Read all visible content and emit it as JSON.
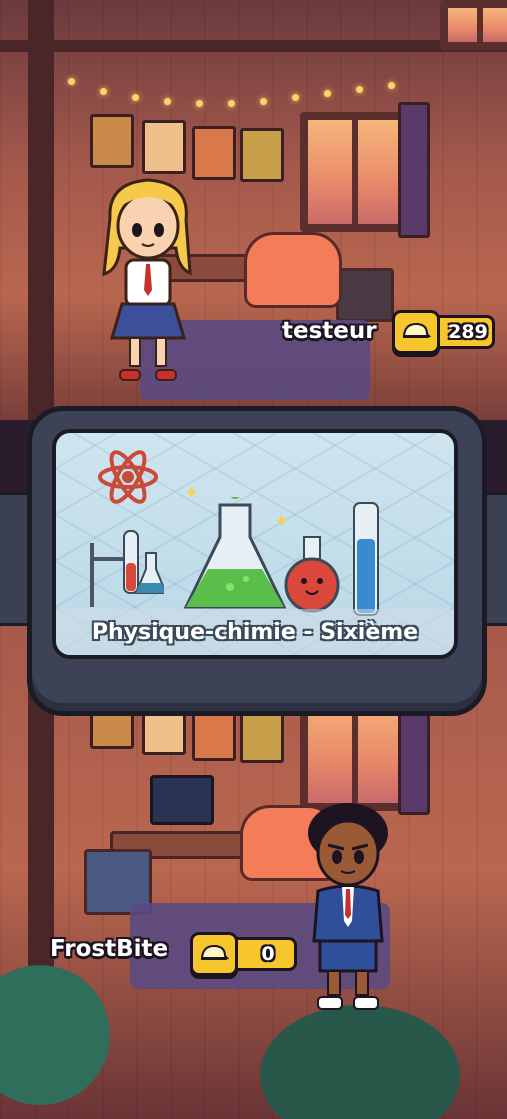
{
  "player_top": {
    "name": "testeur",
    "coins": "289"
  },
  "player_bottom": {
    "name": "FrostBite",
    "coins": "0"
  },
  "subject": {
    "title": "Physique-chimie - Sixième"
  },
  "colors": {
    "coin_yellow": "#f7c52c",
    "panel": "#3d4257",
    "outline": "#1c1420"
  },
  "icons": {
    "coin": "cap-coin-icon",
    "atom": "atom-icon",
    "flask": "flask-icon"
  }
}
